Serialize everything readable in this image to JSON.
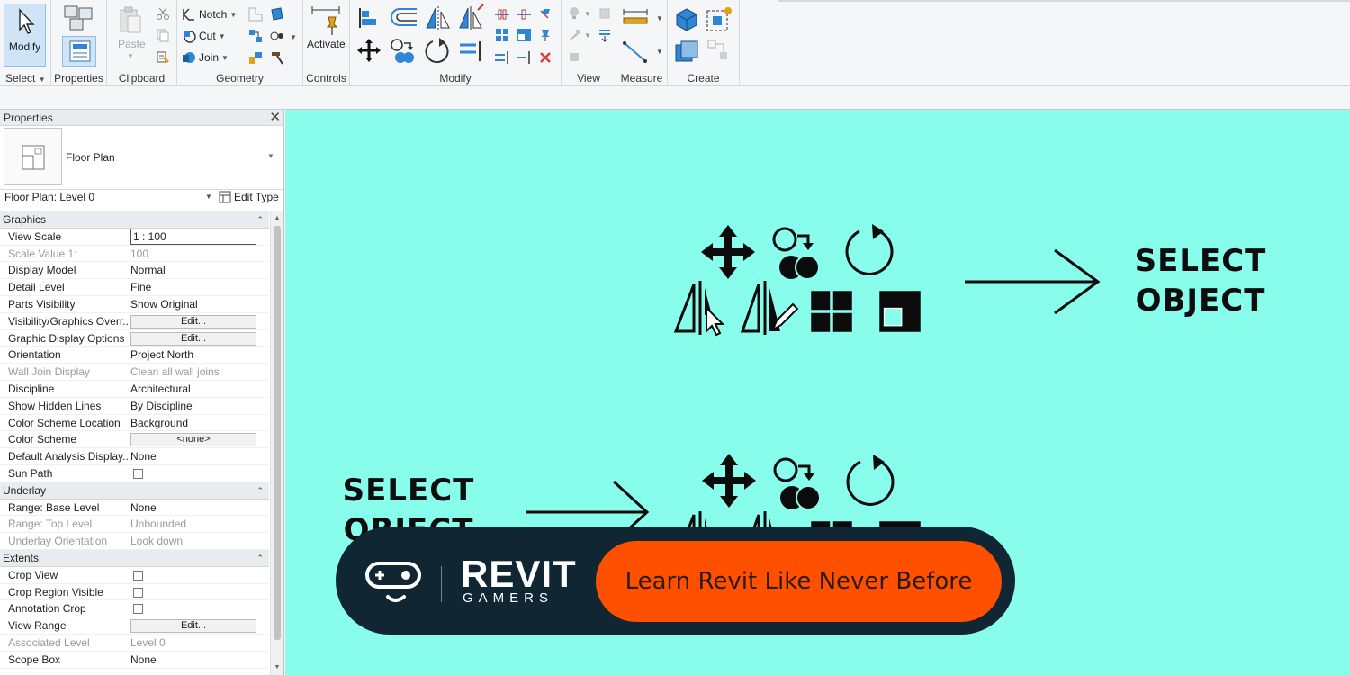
{
  "ribbon": {
    "modify_label": "Modify",
    "select_label": "Select",
    "panels": {
      "properties": "Properties",
      "clipboard": "Clipboard",
      "geometry": "Geometry",
      "controls": "Controls",
      "modify": "Modify",
      "view": "View",
      "measure": "Measure",
      "create": "Create"
    },
    "clipboard": {
      "paste": "Paste"
    },
    "geometry": {
      "notch": "Notch",
      "cut": "Cut",
      "join": "Join"
    },
    "controls": {
      "activate": "Activate"
    }
  },
  "properties": {
    "title": "Properties",
    "type_name": "Floor Plan",
    "instance_selector": "Floor Plan: Level 0",
    "edit_type": "Edit Type",
    "sections": [
      {
        "name": "Graphics",
        "rows": [
          {
            "key": "View Scale",
            "value": "1 : 100",
            "kind": "input"
          },
          {
            "key": "Scale Value    1:",
            "value": "100",
            "kind": "text",
            "dim": true
          },
          {
            "key": "Display Model",
            "value": "Normal",
            "kind": "text"
          },
          {
            "key": "Detail Level",
            "value": "Fine",
            "kind": "text"
          },
          {
            "key": "Parts Visibility",
            "value": "Show Original",
            "kind": "text"
          },
          {
            "key": "Visibility/Graphics Overr...",
            "value": "Edit...",
            "kind": "button"
          },
          {
            "key": "Graphic Display Options",
            "value": "Edit...",
            "kind": "button"
          },
          {
            "key": "Orientation",
            "value": "Project North",
            "kind": "text"
          },
          {
            "key": "Wall Join Display",
            "value": "Clean all wall joins",
            "kind": "text",
            "dim": true
          },
          {
            "key": "Discipline",
            "value": "Architectural",
            "kind": "text"
          },
          {
            "key": "Show Hidden Lines",
            "value": "By Discipline",
            "kind": "text"
          },
          {
            "key": "Color Scheme Location",
            "value": "Background",
            "kind": "text"
          },
          {
            "key": "Color Scheme",
            "value": "<none>",
            "kind": "button"
          },
          {
            "key": "Default Analysis Display...",
            "value": "None",
            "kind": "text"
          },
          {
            "key": "Sun Path",
            "value": "",
            "kind": "check"
          }
        ]
      },
      {
        "name": "Underlay",
        "rows": [
          {
            "key": "Range: Base Level",
            "value": "None",
            "kind": "text"
          },
          {
            "key": "Range: Top Level",
            "value": "Unbounded",
            "kind": "text",
            "dim": true
          },
          {
            "key": "Underlay Orientation",
            "value": "Look down",
            "kind": "text",
            "dim": true
          }
        ]
      },
      {
        "name": "Extents",
        "rows": [
          {
            "key": "Crop View",
            "value": "",
            "kind": "check"
          },
          {
            "key": "Crop Region Visible",
            "value": "",
            "kind": "check"
          },
          {
            "key": "Annotation Crop",
            "value": "",
            "kind": "check"
          },
          {
            "key": "View Range",
            "value": "Edit...",
            "kind": "button"
          },
          {
            "key": "Associated Level",
            "value": "Level 0",
            "kind": "text",
            "dim": true
          },
          {
            "key": "Scope Box",
            "value": "None",
            "kind": "text"
          }
        ]
      }
    ]
  },
  "canvas": {
    "label_top": [
      "SELECT",
      "OBJECT"
    ],
    "label_bottom": [
      "SELECT",
      "OBJECT"
    ]
  },
  "banner": {
    "brand_top": "REVIT",
    "brand_bottom": "GAMERS",
    "cta": "Learn Revit Like Never Before"
  },
  "colors": {
    "canvas_bg": "#88fdeb",
    "banner_bg": "#102633",
    "cta_bg": "#ff5000",
    "ribbon_bg": "#f5f6f7",
    "active_tool": "#cfe4f7"
  },
  "icons": [
    "cursor-icon",
    "properties-icon",
    "paste-icon",
    "cut-scissors-icon",
    "notch-icon",
    "join-icon",
    "activate-pin-icon",
    "align-icon",
    "offset-icon",
    "mirror-icon",
    "move-icon",
    "copy-icon",
    "rotate-icon",
    "split-icon",
    "array-icon",
    "scale-icon",
    "delete-icon",
    "measure-icon",
    "create-part-icon",
    "create-group-icon",
    "edit-type-icon",
    "floor-plan-icon",
    "close-icon",
    "gamepad-logo-icon"
  ]
}
